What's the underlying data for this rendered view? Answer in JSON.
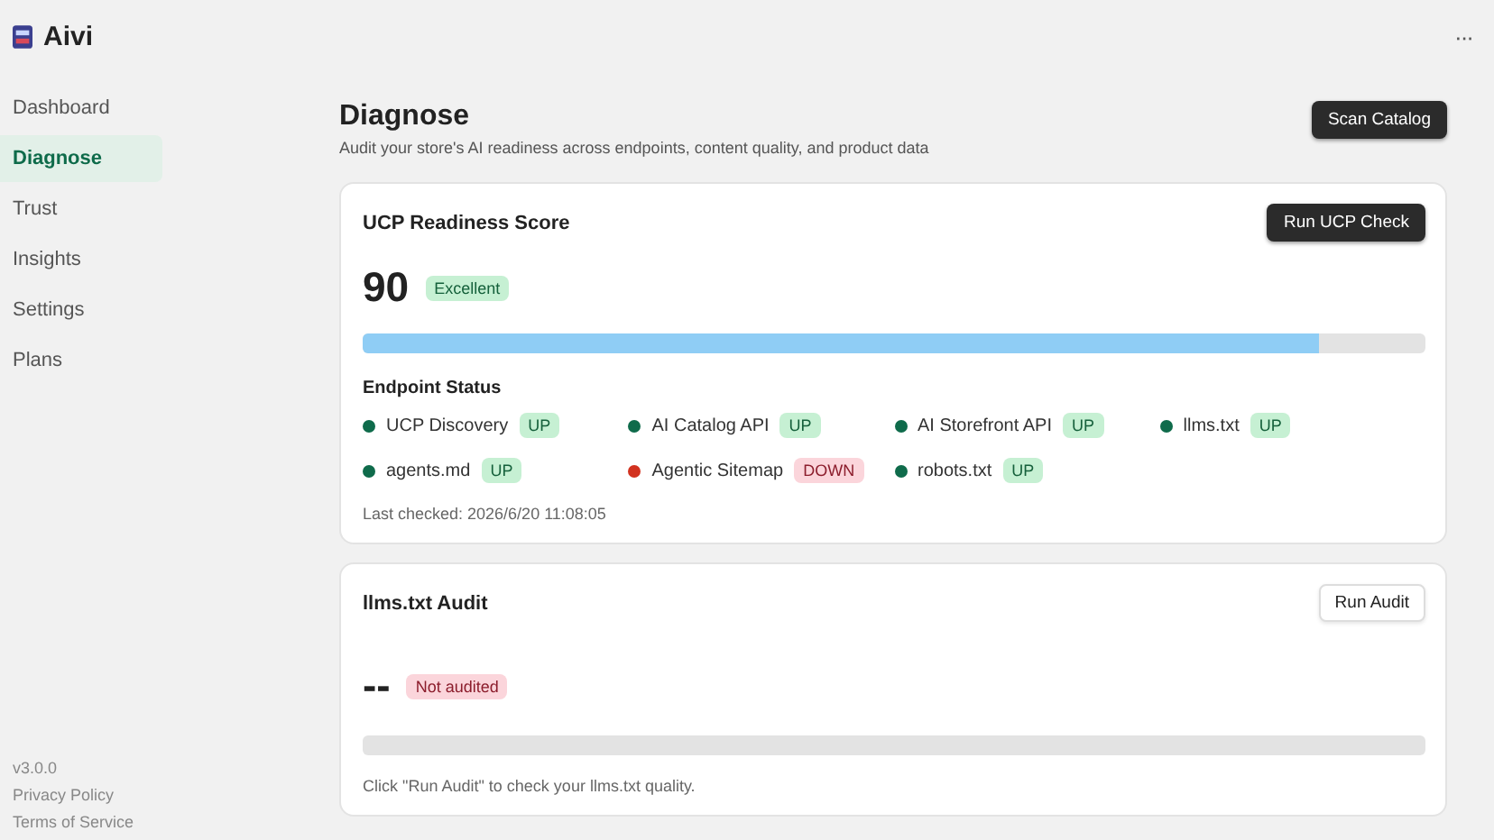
{
  "app": {
    "name": "Aivi",
    "menu": "···"
  },
  "sidebar": {
    "items": [
      {
        "label": "Dashboard",
        "selected": false
      },
      {
        "label": "Diagnose",
        "selected": true
      },
      {
        "label": "Trust",
        "selected": false
      },
      {
        "label": "Insights",
        "selected": false
      },
      {
        "label": "Settings",
        "selected": false
      },
      {
        "label": "Plans",
        "selected": false
      }
    ],
    "footer": [
      "v3.0.0",
      "Privacy Policy",
      "Terms of Service"
    ]
  },
  "page": {
    "title": "Diagnose",
    "subtitle": "Audit your store's AI readiness across endpoints, content quality, and product data",
    "button": "Scan Catalog"
  },
  "ucp": {
    "title": "UCP Readiness Score",
    "button": "Run UCP Check",
    "score": "90",
    "badge": "Excellent",
    "level": 0.9,
    "section": "Endpoint Status",
    "endpoints": [
      {
        "name": "UCP Discovery",
        "status": "UP",
        "up": true
      },
      {
        "name": "AI Catalog API",
        "status": "UP",
        "up": true
      },
      {
        "name": "AI Storefront API",
        "status": "UP",
        "up": true
      },
      {
        "name": "llms.txt",
        "status": "UP",
        "up": true
      },
      {
        "name": "agents.md",
        "status": "UP",
        "up": true
      },
      {
        "name": "Agentic Sitemap",
        "status": "DOWN",
        "up": false
      },
      {
        "name": "robots.txt",
        "status": "UP",
        "up": true
      }
    ],
    "last_checked": "Last checked: 2026/6/20 11:08:05"
  },
  "audit": {
    "title": "llms.txt Audit",
    "button": "Run Audit",
    "score": "--",
    "badge": "Not audited",
    "level": 0,
    "note": "Click \"Run Audit\" to check your llms.txt quality."
  }
}
